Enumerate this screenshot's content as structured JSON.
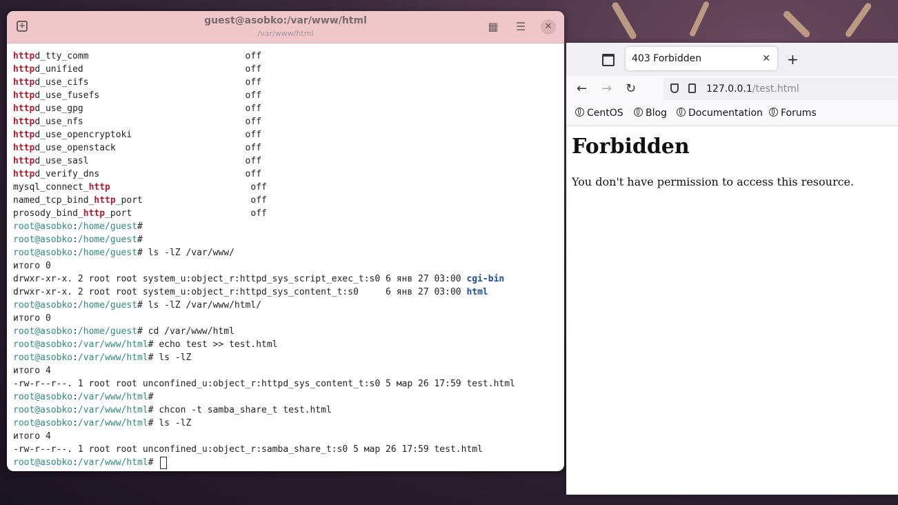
{
  "terminal": {
    "title": "guest@asobko:/var/www/html",
    "subtitle": "/var/www/html",
    "lines": [
      [
        {
          "t": "http",
          "c": "hl"
        },
        {
          "t": "d_tty_comm                             off"
        }
      ],
      [
        {
          "t": "http",
          "c": "hl"
        },
        {
          "t": "d_unified                              off"
        }
      ],
      [
        {
          "t": "http",
          "c": "hl"
        },
        {
          "t": "d_use_cifs                             off"
        }
      ],
      [
        {
          "t": "http",
          "c": "hl"
        },
        {
          "t": "d_use_fusefs                           off"
        }
      ],
      [
        {
          "t": "http",
          "c": "hl"
        },
        {
          "t": "d_use_gpg                              off"
        }
      ],
      [
        {
          "t": "http",
          "c": "hl"
        },
        {
          "t": "d_use_nfs                              off"
        }
      ],
      [
        {
          "t": "http",
          "c": "hl"
        },
        {
          "t": "d_use_opencryptoki                     off"
        }
      ],
      [
        {
          "t": "http",
          "c": "hl"
        },
        {
          "t": "d_use_openstack                        off"
        }
      ],
      [
        {
          "t": "http",
          "c": "hl"
        },
        {
          "t": "d_use_sasl                             off"
        }
      ],
      [
        {
          "t": "http",
          "c": "hl"
        },
        {
          "t": "d_verify_dns                           off"
        }
      ],
      [
        {
          "t": "mysql_connect_"
        },
        {
          "t": "http",
          "c": "hl"
        },
        {
          "t": "                          off"
        }
      ],
      [
        {
          "t": "named_tcp_bind_"
        },
        {
          "t": "http",
          "c": "hl"
        },
        {
          "t": "_port                    off"
        }
      ],
      [
        {
          "t": "prosody_bind_"
        },
        {
          "t": "http",
          "c": "hl"
        },
        {
          "t": "_port                      off"
        }
      ],
      [
        {
          "t": "root@asobko",
          "c": "prompt"
        },
        {
          "t": ":"
        },
        {
          "t": "/home/guest",
          "c": "prompt"
        },
        {
          "t": "#"
        }
      ],
      [
        {
          "t": "root@asobko",
          "c": "prompt"
        },
        {
          "t": ":"
        },
        {
          "t": "/home/guest",
          "c": "prompt"
        },
        {
          "t": "#"
        }
      ],
      [
        {
          "t": "root@asobko",
          "c": "prompt"
        },
        {
          "t": ":"
        },
        {
          "t": "/home/guest",
          "c": "prompt"
        },
        {
          "t": "# ls -lZ /var/www/"
        }
      ],
      [
        {
          "t": "итого 0"
        }
      ],
      [
        {
          "t": "drwxr-xr-x. 2 root root system_u:object_r:httpd_sys_script_exec_t:s0 6 янв 27 03:00 "
        },
        {
          "t": "cgi-bin",
          "c": "dir"
        }
      ],
      [
        {
          "t": "drwxr-xr-x. 2 root root system_u:object_r:httpd_sys_content_t:s0     6 янв 27 03:00 "
        },
        {
          "t": "html",
          "c": "dir"
        }
      ],
      [
        {
          "t": "root@asobko",
          "c": "prompt"
        },
        {
          "t": ":"
        },
        {
          "t": "/home/guest",
          "c": "prompt"
        },
        {
          "t": "# ls -lZ /var/www/html/"
        }
      ],
      [
        {
          "t": "итого 0"
        }
      ],
      [
        {
          "t": "root@asobko",
          "c": "prompt"
        },
        {
          "t": ":"
        },
        {
          "t": "/home/guest",
          "c": "prompt"
        },
        {
          "t": "# cd /var/www/html"
        }
      ],
      [
        {
          "t": "root@asobko",
          "c": "prompt"
        },
        {
          "t": ":"
        },
        {
          "t": "/var/www/html",
          "c": "prompt"
        },
        {
          "t": "# echo test >> test.html"
        }
      ],
      [
        {
          "t": "root@asobko",
          "c": "prompt"
        },
        {
          "t": ":"
        },
        {
          "t": "/var/www/html",
          "c": "prompt"
        },
        {
          "t": "# ls -lZ"
        }
      ],
      [
        {
          "t": "итого 4"
        }
      ],
      [
        {
          "t": "-rw-r--r--. 1 root root unconfined_u:object_r:httpd_sys_content_t:s0 5 мар 26 17:59 test.html"
        }
      ],
      [
        {
          "t": "root@asobko",
          "c": "prompt"
        },
        {
          "t": ":"
        },
        {
          "t": "/var/www/html",
          "c": "prompt"
        },
        {
          "t": "#"
        }
      ],
      [
        {
          "t": "root@asobko",
          "c": "prompt"
        },
        {
          "t": ":"
        },
        {
          "t": "/var/www/html",
          "c": "prompt"
        },
        {
          "t": "# chcon -t samba_share_t test.html"
        }
      ],
      [
        {
          "t": "root@asobko",
          "c": "prompt"
        },
        {
          "t": ":"
        },
        {
          "t": "/var/www/html",
          "c": "prompt"
        },
        {
          "t": "# ls -lZ"
        }
      ],
      [
        {
          "t": "итого 4"
        }
      ],
      [
        {
          "t": "-rw-r--r--. 1 root root unconfined_u:object_r:samba_share_t:s0 5 мар 26 17:59 test.html"
        }
      ],
      [
        {
          "t": "root@asobko",
          "c": "prompt"
        },
        {
          "t": ":"
        },
        {
          "t": "/var/www/html",
          "c": "prompt"
        },
        {
          "t": "# "
        }
      ]
    ]
  },
  "browser": {
    "tab_title": "403 Forbidden",
    "url_host": "127.0.0.1",
    "url_path": "/test.html",
    "bookmarks": [
      "CentOS",
      "Blog",
      "Documentation",
      "Forums"
    ],
    "heading": "Forbidden",
    "message": "You don't have permission to access this resource."
  }
}
